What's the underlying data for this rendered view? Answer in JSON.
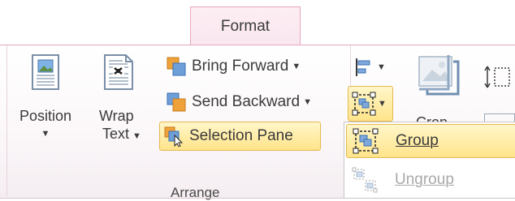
{
  "ribbon": {
    "active_tab": "Format",
    "group_label": "Arrange",
    "position": {
      "label": "Position"
    },
    "wrap_text": {
      "label_line1": "Wrap",
      "label_line2": "Text"
    },
    "bring_forward": {
      "label": "Bring Forward"
    },
    "send_backward": {
      "label": "Send Backward"
    },
    "selection_pane": {
      "label": "Selection Pane"
    },
    "crop_partial": {
      "label": "Crop"
    }
  },
  "group_menu": {
    "items": [
      {
        "label": "Group",
        "state": "highlighted"
      },
      {
        "label": "Ungroup",
        "state": "disabled"
      }
    ]
  },
  "colors": {
    "tab_accent": "#e6a7bf",
    "highlight_fill": "#ffe48a",
    "highlight_border": "#e4b84f",
    "icon_orange": "#f0a23a",
    "icon_blue": "#3a6fb0"
  }
}
